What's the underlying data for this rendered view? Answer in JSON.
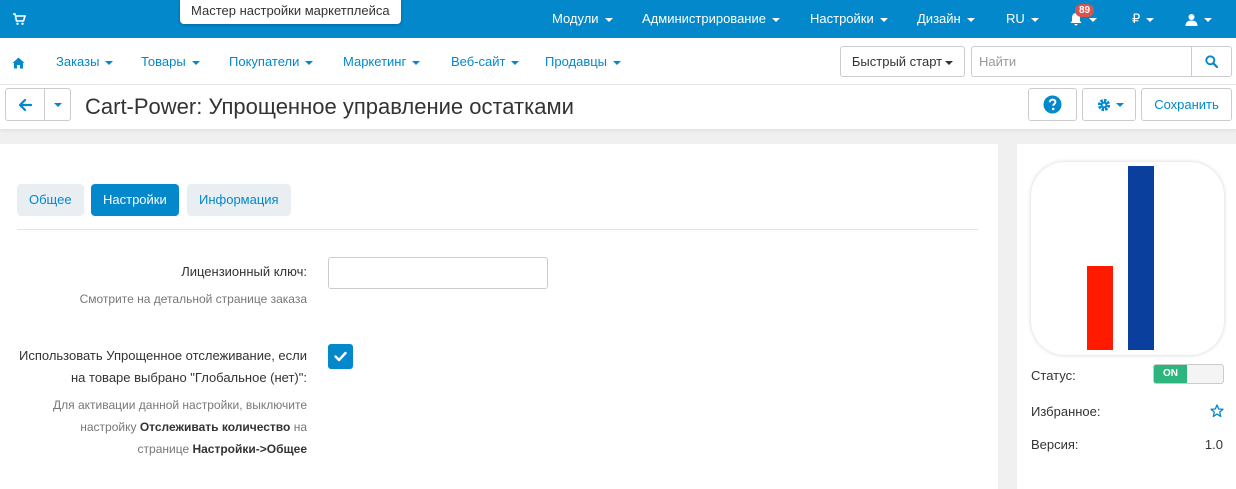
{
  "topbar": {
    "wizard_label": "Мастер настройки маркетплейса",
    "menus": [
      "Модули",
      "Администрирование",
      "Настройки",
      "Дизайн"
    ],
    "language": "RU",
    "notifications_count": "89",
    "currency": "₽",
    "icons": [
      "cart-icon",
      "bell-icon",
      "user-icon"
    ]
  },
  "nav": {
    "items": [
      "Заказы",
      "Товары",
      "Покупатели",
      "Маркетинг",
      "Веб-сайт",
      "Продавцы"
    ],
    "quick_start": "Быстрый старт",
    "search_placeholder": "Найти"
  },
  "header": {
    "title": "Cart-Power: Упрощенное управление остатками",
    "save_label": "Сохранить"
  },
  "tabs": [
    {
      "label": "Общее",
      "active": false
    },
    {
      "label": "Настройки",
      "active": true
    },
    {
      "label": "Информация",
      "active": false
    }
  ],
  "settings": {
    "license_label": "Лицензионный ключ:",
    "license_hint": "Смотрите на детальной странице заказа",
    "license_value": "",
    "simple_tracking_label_line1": "Использовать Упрощенное отслеживание, если",
    "simple_tracking_label_line2": "на товаре выбрано \"Глобальное (нет)\":",
    "simple_tracking_checked": true,
    "hint_part1": "Для активации данной настройки, выключите",
    "hint_part2": "настройку ",
    "hint_bold1": "Отслеживать количество",
    "hint_part3": " на",
    "hint_part4": "странице ",
    "hint_bold2": "Настройки->Общее"
  },
  "sidebar": {
    "status_label": "Статус:",
    "status_value": "ON",
    "favorite_label": "Избранное:",
    "version_label": "Версия:",
    "version_value": "1.0"
  },
  "colors": {
    "accent": "#0388cc",
    "status_on": "#2cb67d",
    "logo_red": "#ff1a00",
    "logo_blue": "#0a3f9e"
  }
}
